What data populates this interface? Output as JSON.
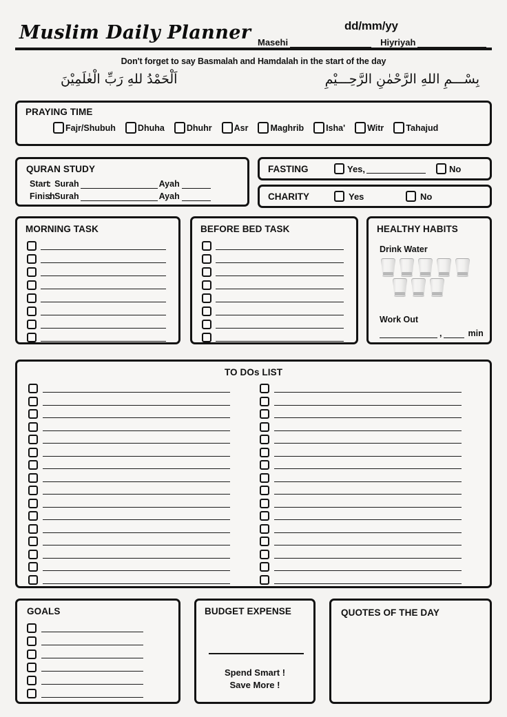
{
  "header": {
    "title": "Muslim Daily Planner",
    "date_format": "dd/mm/yy",
    "masehi_label": "Masehi",
    "hijriyah_label": "Hiyriyah",
    "reminder": "Don't forget to say Basmalah and Hamdalah in the start of the day",
    "arabic_right": "بِسْـــمِ اللهِ الرَّحْمٰنِ الرَّحِـــيْمِ",
    "arabic_left": "اَلْحَمْدُ للهِ رَبِّ الْعٰلَمِيْنَ"
  },
  "praying": {
    "title": "PRAYING TIME",
    "items": [
      {
        "label": "Fajr/Shubuh"
      },
      {
        "label": "Dhuha"
      },
      {
        "label": "Dhuhr"
      },
      {
        "label": "Asr"
      },
      {
        "label": "Maghrib"
      },
      {
        "label": "Isha'"
      },
      {
        "label": "Witr"
      },
      {
        "label": "Tahajud"
      }
    ]
  },
  "quran": {
    "title": "QURAN STUDY",
    "start_label": "Start",
    "finish_label": "Finish",
    "colon": ":",
    "surah_label": "Surah",
    "ayah_label": "Ayah"
  },
  "fasting": {
    "title": "FASTING",
    "yes_label": "Yes,",
    "no_label": "No"
  },
  "charity": {
    "title": "CHARITY",
    "yes_label": "Yes",
    "no_label": "No"
  },
  "morning_task": {
    "title": "MORNING TASK",
    "row_count": 8
  },
  "bed_task": {
    "title": "BEFORE BED TASK",
    "row_count": 8
  },
  "healthy_habits": {
    "title": "HEALTHY HABITS",
    "water_label": "Drink Water",
    "glasses_total": 8,
    "glasses_row1": 5,
    "glasses_row2": 3,
    "workout_label": "Work Out",
    "workout_comma": ",",
    "workout_unit": "min"
  },
  "todos": {
    "title": "TO DOs LIST",
    "left_rows": 16,
    "right_rows": 16
  },
  "goals": {
    "title": "GOALS",
    "row_count": 6
  },
  "budget": {
    "title": "BUDGET EXPENSE",
    "slogan_line1": "Spend Smart !",
    "slogan_line2": "Save More !"
  },
  "quotes": {
    "title": "QUOTES OF THE DAY"
  },
  "colors": {
    "paper": "#f4f3f1",
    "ink": "#121212",
    "box_fill": "#f7f6f4",
    "glass": "#cdcdcd"
  }
}
